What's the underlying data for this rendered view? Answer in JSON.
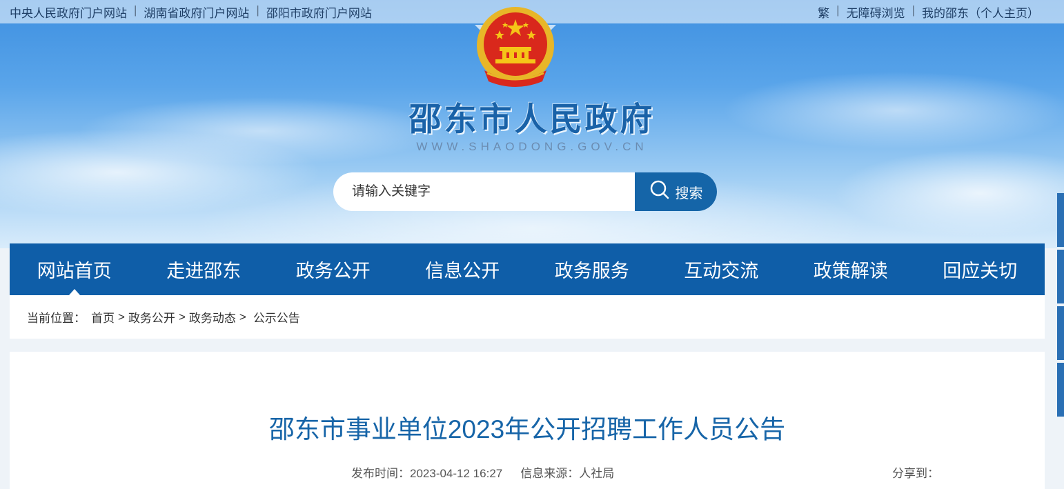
{
  "topbar": {
    "links_left": [
      "中央人民政府门户网站",
      "湖南省政府门户网站",
      "邵阳市政府门户网站"
    ],
    "links_right": [
      "繁",
      "无障碍浏览",
      "我的邵东（个人主页）"
    ],
    "separator": "|"
  },
  "header": {
    "title": "邵东市人民政府",
    "domain": "WWW.SHAODONG.GOV.CN",
    "emblem_icon": "national-emblem-icon"
  },
  "search": {
    "placeholder": "请输入关键字",
    "button_label": "搜索",
    "icon": "search-icon"
  },
  "nav": {
    "items": [
      "网站首页",
      "走进邵东",
      "政务公开",
      "信息公开",
      "政务服务",
      "互动交流",
      "政策解读",
      "回应关切"
    ],
    "active_index": 0
  },
  "breadcrumb": {
    "prefix": "当前位置：",
    "items": [
      "首页",
      "政务公开",
      "政务动态",
      "公示公告"
    ],
    "separator": ">"
  },
  "article": {
    "title": "邵东市事业单位2023年公开招聘工作人员公告",
    "publish_label": "发布时间：",
    "publish_time": "2023-04-12 16:27",
    "source_label": "信息来源：",
    "source": "人社局",
    "share_label": "分享到："
  },
  "colors": {
    "nav_bg": "#0f5ea8",
    "title_blue": "#1765a8",
    "emblem_red": "#d9281c",
    "emblem_gold": "#e8b628"
  }
}
